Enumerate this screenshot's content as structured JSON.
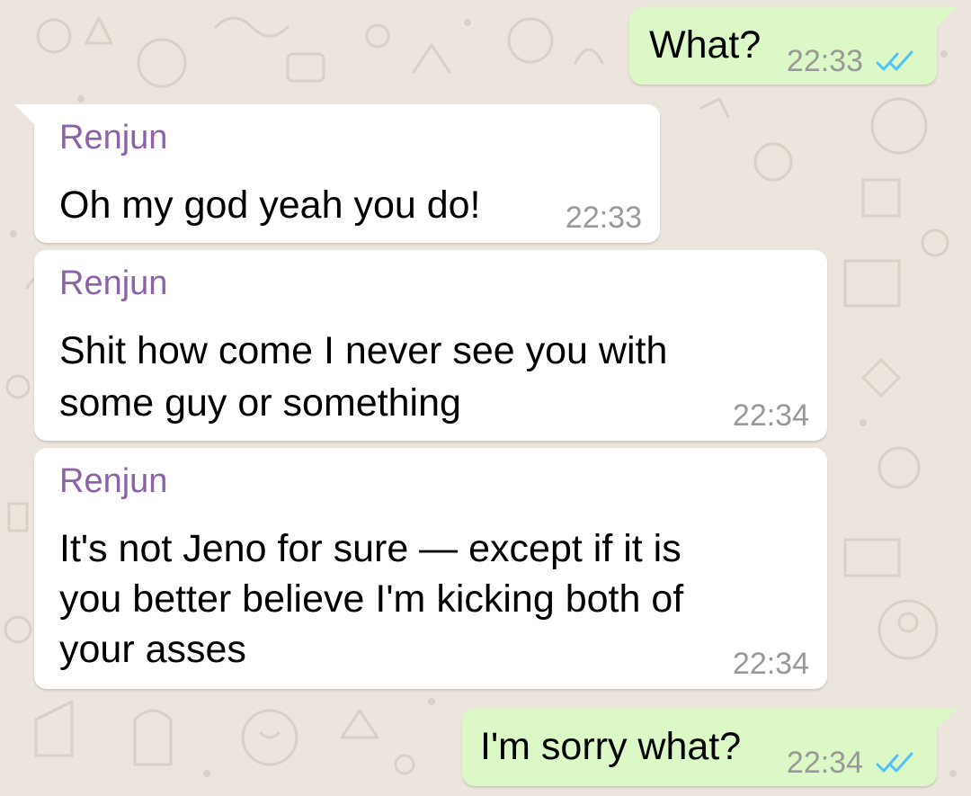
{
  "messages": [
    {
      "direction": "outgoing",
      "text": "What?",
      "time": "22:33",
      "status_icon": "double-check-read-icon"
    },
    {
      "direction": "incoming",
      "sender": "Renjun",
      "text": "Oh my god yeah you do!",
      "time": "22:33"
    },
    {
      "direction": "incoming",
      "sender": "Renjun",
      "lines": [
        "Shit how come I never see you with",
        "some guy or something"
      ],
      "time": "22:34"
    },
    {
      "direction": "incoming",
      "sender": "Renjun",
      "lines": [
        "It's not Jeno for sure — except if it is",
        "you better believe I'm kicking both of",
        "your asses"
      ],
      "time": "22:34"
    },
    {
      "direction": "outgoing",
      "text": "I'm sorry what?",
      "time": "22:34",
      "status_icon": "double-check-read-icon"
    }
  ],
  "colors": {
    "background": "#ece5dd",
    "incoming_bubble": "#ffffff",
    "outgoing_bubble": "#dcf8c6",
    "sender_name": "#8c62a8",
    "timestamp": "#999999",
    "read_ticks": "#4fc3f7"
  }
}
